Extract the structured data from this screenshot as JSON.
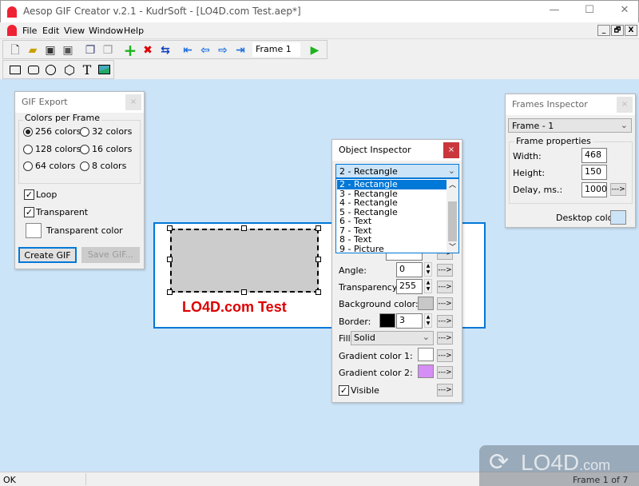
{
  "window": {
    "title": "Aesop GIF Creator v.2.1 - KudrSoft - [LO4D.com Test.aep*]",
    "minimize": "—",
    "maximize": "☐",
    "close": "✕"
  },
  "menu": {
    "items": [
      "File",
      "Edit",
      "View",
      "Window",
      "Help"
    ],
    "mdi_buttons": [
      "_",
      "🗗",
      "X"
    ]
  },
  "toolbar": {
    "frame_field": "Frame 1",
    "icons": [
      "new-icon",
      "open-icon",
      "save-icon",
      "save-as-icon",
      "copy-icon",
      "paste-icon",
      "add-frame-icon",
      "delete-frame-icon",
      "swap-frame-icon",
      "first-frame-icon",
      "prev-frame-icon",
      "next-frame-icon",
      "last-frame-icon",
      "play-icon"
    ]
  },
  "shapes_toolbar": {
    "icons": [
      "rectangle-icon",
      "rounded-rectangle-icon",
      "ellipse-icon",
      "hexagon-icon",
      "text-icon",
      "picture-icon"
    ]
  },
  "gif_export": {
    "title": "GIF Export",
    "close": "×",
    "group": "Colors per Frame",
    "colors": [
      {
        "label": "256 colors",
        "selected": true
      },
      {
        "label": "32 colors",
        "selected": false
      },
      {
        "label": "128 colors",
        "selected": false
      },
      {
        "label": "16 colors",
        "selected": false
      },
      {
        "label": "64 colors",
        "selected": false
      },
      {
        "label": "8 colors",
        "selected": false
      }
    ],
    "loop": {
      "label": "Loop",
      "checked": true
    },
    "transparent": {
      "label": "Transparent",
      "checked": true
    },
    "transparent_color": "Transparent color",
    "create": "Create GIF",
    "save": "Save GIF..."
  },
  "canvas": {
    "text": "LO4D.com Test",
    "text_color": "#dd0000",
    "rect_fill": "#cccccc",
    "frame_border": "#0078d7"
  },
  "object_inspector": {
    "title": "Object Inspector",
    "close": "×",
    "selected": "2 - Rectangle",
    "list": [
      "2 - Rectangle",
      "3 - Rectangle",
      "4 - Rectangle",
      "5 - Rectangle",
      "6 - Text",
      "7 - Text",
      "8 - Text",
      "9 - Picture"
    ],
    "angle": {
      "label": "Angle:",
      "value": "0"
    },
    "transparency": {
      "label": "Transparency:",
      "value": "255"
    },
    "background": {
      "label": "Background color:",
      "color": "#c8c8c8"
    },
    "border": {
      "label": "Border:",
      "value": "3",
      "color": "#000000"
    },
    "fill": {
      "label": "Fill:",
      "value": "Solid"
    },
    "gradient1": {
      "label": "Gradient color 1:",
      "color": "#ffffff"
    },
    "gradient2": {
      "label": "Gradient color 2:",
      "color": "#d58ef5"
    },
    "visible": {
      "label": "Visible",
      "checked": true
    },
    "apply": "--->"
  },
  "frames_inspector": {
    "title": "Frames Inspector",
    "close": "×",
    "frame": "Frame - 1",
    "group": "Frame properties",
    "width": {
      "label": "Width:",
      "value": "468"
    },
    "height": {
      "label": "Height:",
      "value": "150"
    },
    "delay": {
      "label": "Delay, ms.:",
      "value": "1000"
    },
    "apply": "--->",
    "desktop_color": {
      "label": "Desktop color:",
      "color": "#cce4f8"
    }
  },
  "status": {
    "left": "OK",
    "right": "Frame 1 of 7"
  },
  "watermark": "LO4D.com"
}
